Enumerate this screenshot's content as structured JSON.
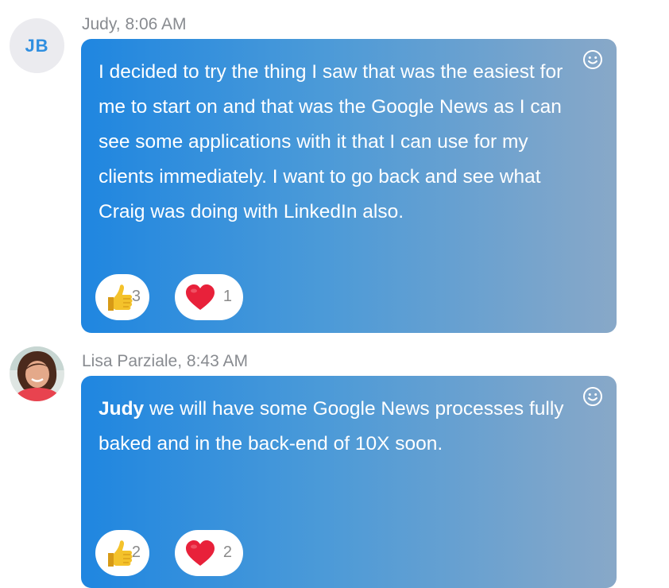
{
  "messages": [
    {
      "author": "Judy, 8:06 AM",
      "avatar_initials": "JB",
      "text_plain": "I decided to try the thing I saw that was the easiest for me to start on and that was the Google News as I can see some applications with it that I can use for my clients immediately. I want to go back and see what Craig was doing with LinkedIn also.",
      "reactions": [
        {
          "icon": "thumbs-up-icon",
          "count": "3"
        },
        {
          "icon": "heart-icon",
          "count": "1"
        }
      ]
    },
    {
      "author": "Lisa Parziale, 8:43 AM",
      "avatar_icon": "user-photo",
      "mention": "Judy",
      "text_rest": " we will have some Google News processes fully baked and in the back-end of 10X soon.",
      "reactions": [
        {
          "icon": "thumbs-up-icon",
          "count": "2"
        },
        {
          "icon": "heart-icon",
          "count": "2"
        }
      ]
    }
  ],
  "colors": {
    "bubble_start": "#1f86e0",
    "bubble_end": "#88a8c8",
    "author_text": "#888b90",
    "initials": "#2f8fe0",
    "heart": "#e8213a",
    "thumb": "#f4c22b"
  }
}
